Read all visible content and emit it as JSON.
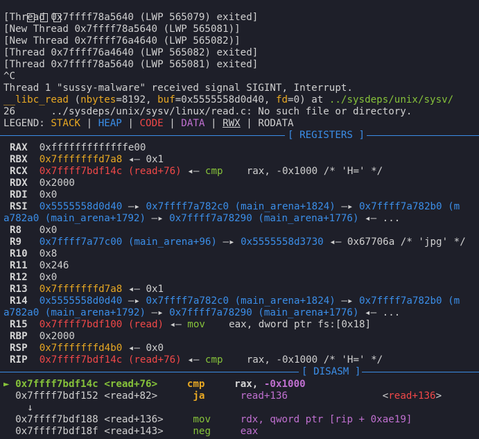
{
  "thread_lines": [
    "[Thread 0x7ffff78a5640 (LWP 565079) exited]",
    "[New Thread 0x7ffff78a5640 (LWP 565081)]",
    "[New Thread 0x7ffff76a4640 (LWP 565082)]",
    "[Thread 0x7ffff76a4640 (LWP 565082) exited]",
    "[Thread 0x7ffff78a5640 (LWP 565081) exited]"
  ],
  "interrupt": "^C",
  "signal_msg": "Thread 1 \"sussy-malware\" received signal SIGINT, Interrupt.",
  "libc_read": {
    "fn": "__libc_read",
    "open": " (",
    "a1": "nbytes",
    "v1": "=8192, ",
    "a2": "buf",
    "v2": "=0x5555558d0d40, ",
    "a3": "fd",
    "v3": "=0) at ",
    "path": "../sysdeps/unix/sysv/"
  },
  "source_line": "26      ../sysdeps/unix/sysv/linux/read.c: No such file or directory.",
  "legend": {
    "label": "LEGEND: ",
    "stack": "STACK",
    "heap": "HEAP",
    "code": "CODE",
    "data": "DATA",
    "rwx": "RWX",
    "rodata": "RODATA",
    "bar": " | "
  },
  "registers_title": "[ REGISTERS ]",
  "disasm_title": "[ DISASM ]",
  "registers": {
    "rax": {
      "name": "RAX",
      "val": "0xfffffffffffffe00"
    },
    "rbx": {
      "name": "RBX",
      "addr": "0x7fffffffd7a8",
      "rest": " ◂— 0x1"
    },
    "rcx": {
      "name": "RCX",
      "addr": "0x7ffff7bdf14c",
      "sym": " (read+76)",
      "arrow": " ◂— ",
      "ins": "cmp",
      "ops1": "rax, ",
      "imm": "-0x1000",
      "cmt": " /* 'H=' */"
    },
    "rdx": {
      "name": "RDX",
      "val": "0x2000"
    },
    "rdi": {
      "name": "RDI",
      "val": "0x0"
    },
    "rsi": {
      "name": "RSI",
      "a": "0x5555558d0d40",
      "b": "0x7ffff7a782c0 (main_arena+1824)",
      "c": "0x7ffff7a782b0 (m",
      "cont1": "a782a0 (main_arena+1792)",
      "cont2": "0x7ffff7a78290 (main_arena+1776)",
      "tail": " ◂— ..."
    },
    "r8": {
      "name": "R8",
      "val": "0x0"
    },
    "r9": {
      "name": "R9",
      "a": "0x7ffff7a77c00 (main_arena+96)",
      "b": "0x5555558d3730",
      "rest": " ◂— 0x67706a /* 'jpg' */"
    },
    "r10": {
      "name": "R10",
      "val": "0x8"
    },
    "r11": {
      "name": "R11",
      "val": "0x246"
    },
    "r12": {
      "name": "R12",
      "val": "0x0"
    },
    "r13": {
      "name": "R13",
      "addr": "0x7fffffffd7a8",
      "rest": " ◂— 0x1"
    },
    "r14": {
      "name": "R14",
      "a": "0x5555558d0d40",
      "b": "0x7ffff7a782c0 (main_arena+1824)",
      "c": "0x7ffff7a782b0 (m",
      "cont1": "a782a0 (main_arena+1792)",
      "cont2": "0x7ffff7a78290 (main_arena+1776)",
      "tail": " ◂— ..."
    },
    "r15": {
      "name": "R15",
      "addr": "0x7ffff7bdf100",
      "sym": " (read)",
      "arrow": " ◂— ",
      "ins": "mov",
      "ops1": "eax, dword ptr fs:[",
      "imm": "0x18",
      "ops2": "]"
    },
    "rbp": {
      "name": "RBP",
      "val": "0x2000"
    },
    "rsp": {
      "name": "RSP",
      "addr": "0x7fffffffd4b0",
      "rest": " ◂— 0x0"
    },
    "rip": {
      "name": "RIP",
      "addr": "0x7ffff7bdf14c",
      "sym": " (read+76)",
      "arrow": " ◂— ",
      "ins": "cmp",
      "ops1": "rax, ",
      "imm": "-0x1000",
      "cmt": " /* 'H=' */"
    }
  },
  "disasm": [
    {
      "marker": "►",
      "addr": "0x7ffff7bdf14c",
      "sym": "<read+76>",
      "ins": "cmp",
      "ops": "rax, ",
      "imm": "-0x1000"
    },
    {
      "addr": "0x7ffff7bdf152",
      "sym": "<read+82>",
      "ins": "ja",
      "ops": "read+136",
      "target_open": "<",
      "target": "read+136",
      "target_close": ">"
    },
    {
      "arrow": "↓"
    },
    {
      "addr": "0x7ffff7bdf188",
      "sym": "<read+136>",
      "ins": "mov",
      "ops": "rdx, qword ptr [rip + ",
      "imm": "0xae19",
      "ops2": "]"
    },
    {
      "addr": "0x7ffff7bdf18f",
      "sym": "<read+143>",
      "ins": "neg",
      "ops": "eax"
    }
  ],
  "colors": {
    "bg": "#1e1f29",
    "stack": "#e8a823",
    "heap": "#3b8ee8",
    "code": "#f04848",
    "data": "#c070d0",
    "rwx": "#d3d3d3",
    "instr": "#86c23a"
  }
}
